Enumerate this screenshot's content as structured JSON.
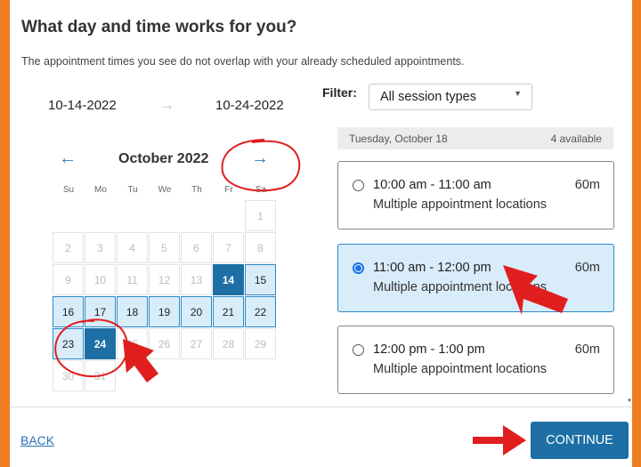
{
  "header": {
    "title": "What day and time works for you?",
    "subtitle": "The appointment times you see do not overlap with your already scheduled appointments."
  },
  "date_range": {
    "start": "10-14-2022",
    "arrow": "→",
    "end": "10-24-2022"
  },
  "calendar": {
    "prev_icon": "←",
    "next_icon": "→",
    "month_label": "October 2022",
    "weekdays": [
      "Su",
      "Mo",
      "Tu",
      "We",
      "Th",
      "Fr",
      "Sa"
    ],
    "weeks": [
      [
        {
          "d": ""
        },
        {
          "d": ""
        },
        {
          "d": ""
        },
        {
          "d": ""
        },
        {
          "d": ""
        },
        {
          "d": ""
        },
        {
          "d": "1",
          "s": "disabled"
        }
      ],
      [
        {
          "d": "2",
          "s": "disabled"
        },
        {
          "d": "3",
          "s": "disabled"
        },
        {
          "d": "4",
          "s": "disabled"
        },
        {
          "d": "5",
          "s": "disabled"
        },
        {
          "d": "6",
          "s": "disabled"
        },
        {
          "d": "7",
          "s": "disabled"
        },
        {
          "d": "8",
          "s": "disabled"
        }
      ],
      [
        {
          "d": "9",
          "s": "disabled"
        },
        {
          "d": "10",
          "s": "disabled"
        },
        {
          "d": "11",
          "s": "disabled"
        },
        {
          "d": "12",
          "s": "disabled"
        },
        {
          "d": "13",
          "s": "disabled"
        },
        {
          "d": "14",
          "s": "selected"
        },
        {
          "d": "15",
          "s": "available"
        }
      ],
      [
        {
          "d": "16",
          "s": "available"
        },
        {
          "d": "17",
          "s": "available"
        },
        {
          "d": "18",
          "s": "available"
        },
        {
          "d": "19",
          "s": "available"
        },
        {
          "d": "20",
          "s": "available"
        },
        {
          "d": "21",
          "s": "available"
        },
        {
          "d": "22",
          "s": "available"
        }
      ],
      [
        {
          "d": "23",
          "s": "available"
        },
        {
          "d": "24",
          "s": "selected"
        },
        {
          "d": "25",
          "s": "disabled"
        },
        {
          "d": "26",
          "s": "disabled"
        },
        {
          "d": "27",
          "s": "disabled"
        },
        {
          "d": "28",
          "s": "disabled"
        },
        {
          "d": "29",
          "s": "disabled"
        }
      ],
      [
        {
          "d": "30",
          "s": "disabled"
        },
        {
          "d": "31",
          "s": "disabled"
        },
        {
          "d": ""
        },
        {
          "d": ""
        },
        {
          "d": ""
        },
        {
          "d": ""
        },
        {
          "d": ""
        }
      ]
    ]
  },
  "filter": {
    "label": "Filter:",
    "value": "All session types",
    "caret": "▼"
  },
  "date_header": {
    "day": "Tuesday, October 18",
    "count": "4 available"
  },
  "slots": [
    {
      "time": "10:00 am - 11:00 am",
      "location": "Multiple appointment locations",
      "duration": "60m",
      "selected": false
    },
    {
      "time": "11:00 am - 12:00 pm",
      "location": "Multiple appointment locations",
      "duration": "60m",
      "selected": true
    },
    {
      "time": "12:00 pm - 1:00 pm",
      "location": "Multiple appointment locations",
      "duration": "60m",
      "selected": false
    }
  ],
  "footer": {
    "back_label": "BACK",
    "continue_label": "CONTINUE"
  },
  "colors": {
    "frame_orange": "#ef7d22",
    "accent_blue": "#1d6fa5",
    "available_fill": "#d9ecfa",
    "annotation_red": "#e11e1e"
  },
  "icons": {
    "scroll_down": "▼"
  }
}
